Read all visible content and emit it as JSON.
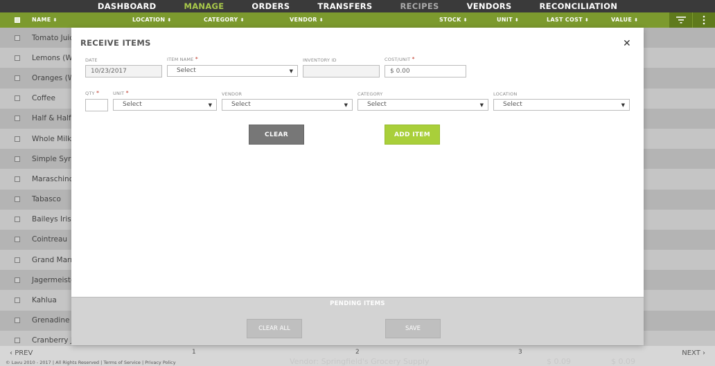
{
  "nav": {
    "items": [
      {
        "label": "DASHBOARD",
        "state": "normal"
      },
      {
        "label": "MANAGE",
        "state": "active"
      },
      {
        "label": "ORDERS",
        "state": "normal"
      },
      {
        "label": "TRANSFERS",
        "state": "normal"
      },
      {
        "label": "RECIPES",
        "state": "dim"
      },
      {
        "label": "VENDORS",
        "state": "normal"
      },
      {
        "label": "RECONCILIATION",
        "state": "normal"
      }
    ]
  },
  "columns": {
    "name": "NAME",
    "location": "LOCATION",
    "category": "CATEGORY",
    "vendor": "VENDOR",
    "stock": "STOCK",
    "unit": "UNIT",
    "last_cost": "LAST COST",
    "value": "VALUE"
  },
  "rows": [
    "Tomato Juice",
    "Lemons (Wh",
    "Oranges (Wh",
    "Coffee",
    "Half & Half",
    "Whole Milk",
    "Simple Syru",
    "Maraschino",
    "Tabasco",
    "Baileys Irish",
    "Cointreau",
    "Grand Marn",
    "Jagermeister",
    "Kahlua",
    "Grenadine",
    "Cranberry Ju"
  ],
  "modal": {
    "title": "RECEIVE ITEMS",
    "close_glyph": "✕",
    "date_label": "DATE",
    "date_value": "10/23/2017",
    "item_name_label": "ITEM NAME",
    "item_name_value": "Select",
    "inventory_id_label": "INVENTORY ID",
    "inventory_id_value": "",
    "cost_unit_label": "COST/UNIT",
    "cost_unit_value": "$ 0.00",
    "qty_label": "QTY",
    "qty_value": "",
    "unit_label": "UNIT",
    "unit_value": "Select",
    "vendor_label": "VENDOR",
    "vendor_value": "Select",
    "category_label": "CATEGORY",
    "category_value": "Select",
    "location_label": "LOCATION",
    "location_value": "Select",
    "required_mark": "*",
    "clear_label": "CLEAR",
    "add_item_label": "ADD ITEM",
    "pending_title": "PENDING ITEMS",
    "clear_all_label": "CLEAR ALL",
    "save_label": "SAVE"
  },
  "footer": {
    "prev": "PREV",
    "next": "NEXT",
    "pages": [
      "1",
      "2",
      "3"
    ],
    "copyright": "© Lavu 2010 - 2017 | All Rights Reserved | Terms of Service | Privacy Policy",
    "ghost_vendor": "Vendor: Springfield's Grocery Supply",
    "ghost_cost": "$ 0.09",
    "ghost_value": "$ 0.09"
  },
  "colors": {
    "accent": "#7c9a2e",
    "nav_active": "#a9c94a",
    "add_button": "#a9cf3a"
  }
}
